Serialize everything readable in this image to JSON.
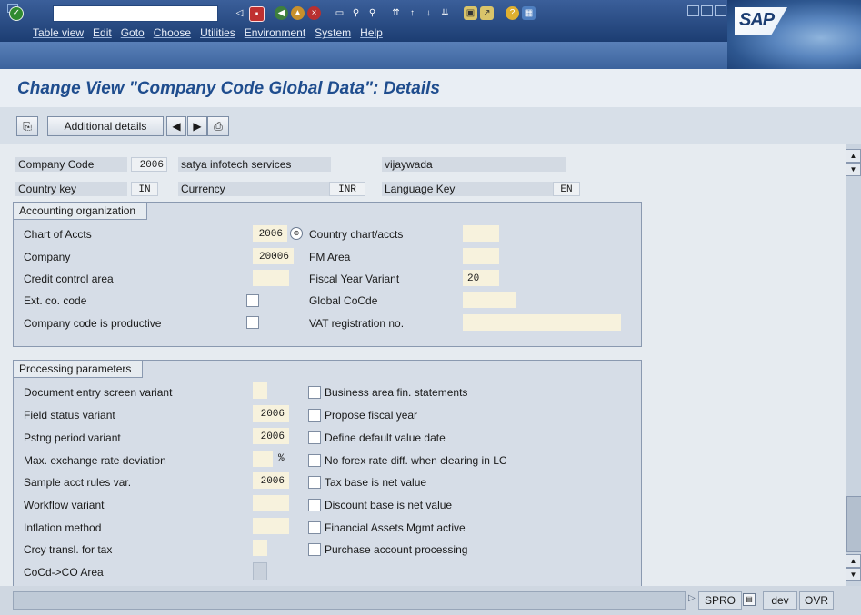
{
  "window": {
    "menu": [
      "Table view",
      "Edit",
      "Goto",
      "Choose",
      "Utilities",
      "Environment",
      "System",
      "Help"
    ],
    "logo": "SAP"
  },
  "title": "Change View \"Company Code Global Data\": Details",
  "app_toolbar": {
    "additional_details": "Additional details"
  },
  "header": {
    "company_code_label": "Company Code",
    "company_code": "2006",
    "company_name": "satya infotech services",
    "city": "vijaywada",
    "country_key_label": "Country key",
    "country_key": "IN",
    "currency_label": "Currency",
    "currency": "INR",
    "language_label": "Language Key",
    "language": "EN"
  },
  "accounting_org": {
    "title": "Accounting organization",
    "chart_of_accts_label": "Chart of Accts",
    "chart_of_accts": "2006",
    "country_chart_label": "Country chart/accts",
    "country_chart": "",
    "company_label": "Company",
    "company": "20006",
    "fm_area_label": "FM Area",
    "fm_area": "",
    "credit_control_label": "Credit control area",
    "credit_control": "",
    "fiscal_year_label": "Fiscal Year Variant",
    "fiscal_year": "20",
    "ext_co_label": "Ext. co. code",
    "global_cocde_label": "Global CoCde",
    "global_cocde": "",
    "productive_label": "Company code is productive",
    "vat_label": "VAT registration no.",
    "vat": ""
  },
  "processing": {
    "title": "Processing parameters",
    "doc_entry_label": "Document entry screen variant",
    "doc_entry": "",
    "field_status_label": "Field status variant",
    "field_status": "2006",
    "pstng_period_label": "Pstng period variant",
    "pstng_period": "2006",
    "max_exch_label": "Max. exchange rate deviation",
    "max_exch": "",
    "max_exch_unit": "%",
    "sample_acct_label": "Sample acct rules var.",
    "sample_acct": "2006",
    "workflow_label": "Workflow variant",
    "workflow": "",
    "inflation_label": "Inflation method",
    "inflation": "",
    "crcy_transl_label": "Crcy transl. for tax",
    "crcy_transl": "",
    "cocd_co_label": "CoCd->CO Area",
    "checkboxes": [
      "Business area fin. statements",
      "Propose fiscal year",
      "Define default value date",
      "No forex rate diff. when clearing in LC",
      "Tax base is net value",
      "Discount base is net value",
      "Financial Assets Mgmt active",
      "Purchase account processing"
    ]
  },
  "status": {
    "transaction": "SPRO",
    "system": "dev",
    "mode": "OVR"
  }
}
